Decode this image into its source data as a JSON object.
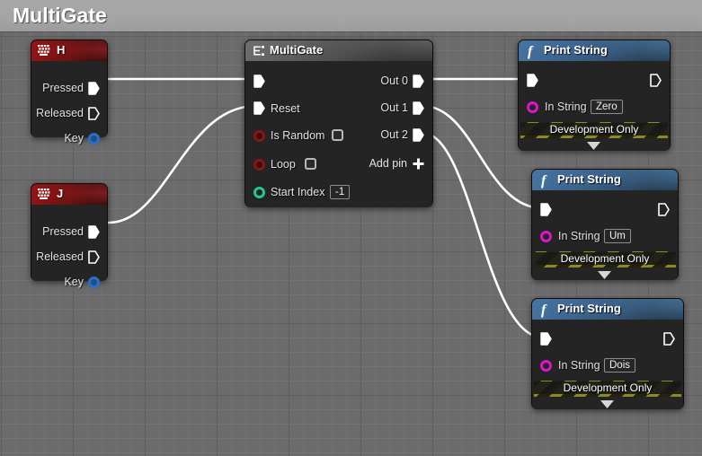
{
  "window": {
    "title": "MultiGate"
  },
  "theme": {
    "canvas_bg": "#6b6b6b",
    "titlebar_bg": "#a4a4a4",
    "node_bg": "#242424",
    "event_header": "#8d1c1c",
    "function_header": "#3c668d",
    "flow_header": "#555555",
    "wire_color": "#ffffff",
    "exec_pin": "#ffffff",
    "string_pin": "#d817c6",
    "int_pin": "#23c98a",
    "bool_pin": "#8c1414",
    "key_pin": "#2a6fc4",
    "dev_banner": "#8d8b20"
  },
  "nodes": [
    {
      "id": "key-h",
      "type": "event",
      "icon": "keyboard-icon",
      "title": "H",
      "pins_out": [
        {
          "label": "Pressed",
          "kind": "exec",
          "filled": true
        },
        {
          "label": "Released",
          "kind": "exec",
          "filled": false
        },
        {
          "label": "Key",
          "kind": "data",
          "color": "key"
        }
      ]
    },
    {
      "id": "key-j",
      "type": "event",
      "icon": "keyboard-icon",
      "title": "J",
      "pins_out": [
        {
          "label": "Pressed",
          "kind": "exec",
          "filled": true
        },
        {
          "label": "Released",
          "kind": "exec",
          "filled": false
        },
        {
          "label": "Key",
          "kind": "data",
          "color": "key"
        }
      ]
    },
    {
      "id": "multigate",
      "type": "flow",
      "icon": "multigate-icon",
      "title": "MultiGate",
      "pins_in": [
        {
          "label": "",
          "kind": "exec"
        },
        {
          "label": "Reset",
          "kind": "exec"
        },
        {
          "label": "Is Random",
          "kind": "bool",
          "checkbox": true,
          "checked": false
        },
        {
          "label": "Loop",
          "kind": "bool",
          "checkbox": true,
          "checked": false
        },
        {
          "label": "Start Index",
          "kind": "int",
          "value": "-1"
        }
      ],
      "pins_out": [
        {
          "label": "Out 0",
          "kind": "exec"
        },
        {
          "label": "Out 1",
          "kind": "exec"
        },
        {
          "label": "Out 2",
          "kind": "exec"
        }
      ],
      "add_pin_label": "Add pin"
    },
    {
      "id": "print-zero",
      "type": "function",
      "icon": "function-icon",
      "title": "Print String",
      "in_string_label": "In String",
      "in_string_value": "Zero",
      "dev_banner": "Development Only"
    },
    {
      "id": "print-um",
      "type": "function",
      "icon": "function-icon",
      "title": "Print String",
      "in_string_label": "In String",
      "in_string_value": "Um",
      "dev_banner": "Development Only"
    },
    {
      "id": "print-dois",
      "type": "function",
      "icon": "function-icon",
      "title": "Print String",
      "in_string_label": "In String",
      "in_string_value": "Dois",
      "dev_banner": "Development Only"
    }
  ],
  "connections": [
    {
      "from": "key-h.Pressed",
      "to": "multigate.exec-in"
    },
    {
      "from": "key-j.Pressed",
      "to": "multigate.Reset"
    },
    {
      "from": "multigate.Out 0",
      "to": "print-zero.exec-in"
    },
    {
      "from": "multigate.Out 1",
      "to": "print-um.exec-in"
    },
    {
      "from": "multigate.Out 2",
      "to": "print-dois.exec-in"
    }
  ]
}
